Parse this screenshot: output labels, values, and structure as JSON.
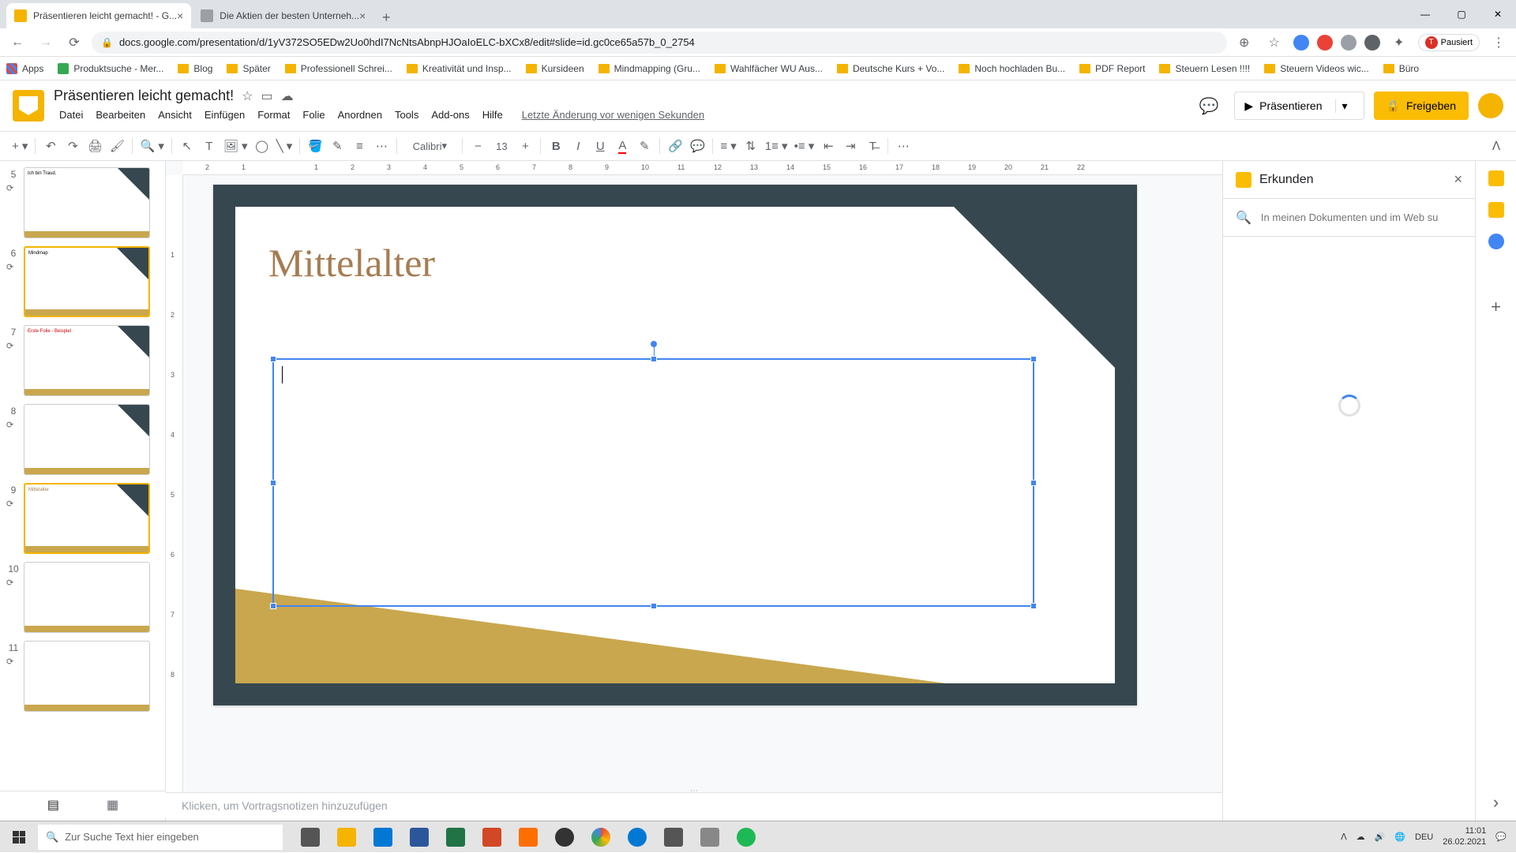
{
  "browser": {
    "tabs": [
      {
        "title": "Präsentieren leicht gemacht! - G...",
        "active": true
      },
      {
        "title": "Die Aktien der besten Unterneh...",
        "active": false
      }
    ],
    "url": "docs.google.com/presentation/d/1yV372SO5EDw2Uo0hdI7NcNtsAbnpHJOaIoELC-bXCx8/edit#slide=id.gc0ce65a57b_0_2754",
    "paused_label": "Pausiert"
  },
  "bookmarks": [
    "Apps",
    "Produktsuche - Mer...",
    "Blog",
    "Später",
    "Professionell Schrei...",
    "Kreativität und Insp...",
    "Kursideen",
    "Mindmapping (Gru...",
    "Wahlfächer WU Aus...",
    "Deutsche Kurs + Vo...",
    "Noch hochladen Bu...",
    "PDF Report",
    "Steuern Lesen !!!!",
    "Steuern Videos wic...",
    "Büro"
  ],
  "app": {
    "doc_title": "Präsentieren leicht gemacht!",
    "menus": [
      "Datei",
      "Bearbeiten",
      "Ansicht",
      "Einfügen",
      "Format",
      "Folie",
      "Anordnen",
      "Tools",
      "Add-ons",
      "Hilfe"
    ],
    "last_edit": "Letzte Änderung vor wenigen Sekunden",
    "present_label": "Präsentieren",
    "share_label": "Freigeben"
  },
  "toolbar": {
    "font_family": "Calibri",
    "font_size": "13"
  },
  "ruler_h": [
    2,
    1,
    "",
    1,
    2,
    3,
    4,
    5,
    6,
    7,
    8,
    9,
    10,
    11,
    12,
    13,
    14,
    15,
    16,
    17,
    18,
    19,
    20,
    21,
    22
  ],
  "slide": {
    "title": "Mittelalter"
  },
  "filmstrip": [
    {
      "num": "5",
      "label": "Ich bin Traud.",
      "active": false
    },
    {
      "num": "6",
      "label": "Mindmap",
      "active": true
    },
    {
      "num": "7",
      "label": "Erste Folie - Beispiel",
      "active": false
    },
    {
      "num": "8",
      "label": "",
      "active": false
    },
    {
      "num": "9",
      "label": "Mittelalter",
      "active": false,
      "current": true
    },
    {
      "num": "10",
      "label": "",
      "active": false
    },
    {
      "num": "11",
      "label": "",
      "active": false
    }
  ],
  "notes": {
    "placeholder": "Klicken, um Vortragsnotizen hinzuzufügen"
  },
  "explore": {
    "title": "Erkunden",
    "search_placeholder": "In meinen Dokumenten und im Web su"
  },
  "taskbar": {
    "search_placeholder": "Zur Suche Text hier eingeben",
    "lang": "DEU",
    "time": "11:01",
    "date": "26.02.2021"
  }
}
